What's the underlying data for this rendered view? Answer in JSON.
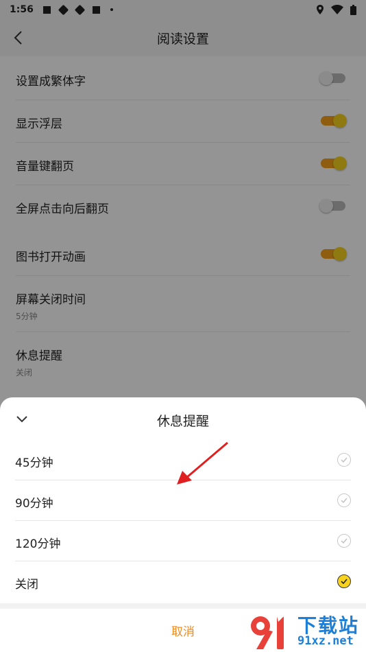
{
  "status_bar": {
    "time": "1:56",
    "icons": [
      "square-notification-icon",
      "app-icon",
      "app-icon",
      "square-notification-icon",
      "dot-icon",
      "location-icon",
      "wifi-icon",
      "battery-icon"
    ]
  },
  "header": {
    "title": "阅读设置",
    "back_icon": "back-arrow-icon"
  },
  "settings": {
    "group1": [
      {
        "label": "设置成繁体字",
        "enabled": false
      },
      {
        "label": "显示浮层",
        "enabled": true
      },
      {
        "label": "音量键翻页",
        "enabled": true
      },
      {
        "label": "全屏点击向后翻页",
        "enabled": false
      }
    ],
    "group2": [
      {
        "label": "图书打开动画",
        "enabled": true
      },
      {
        "label": "屏幕关闭时间",
        "value": "5分钟"
      },
      {
        "label": "休息提醒",
        "value": "关闭"
      }
    ]
  },
  "sheet": {
    "title": "休息提醒",
    "collapse_icon": "chevron-down-icon",
    "options": [
      {
        "label": "45分钟",
        "selected": false
      },
      {
        "label": "90分钟",
        "selected": false
      },
      {
        "label": "120分钟",
        "selected": false
      },
      {
        "label": "关闭",
        "selected": true
      }
    ],
    "cancel_label": "取消"
  },
  "watermark": {
    "title": "下载站",
    "url": "91xz.net"
  },
  "colors": {
    "accent": "#f7d21e",
    "toggle_track_on": "#f4a01a",
    "cancel_text": "#f08a1a",
    "arrow": "#e02020",
    "watermark": "#1e7fd6"
  }
}
